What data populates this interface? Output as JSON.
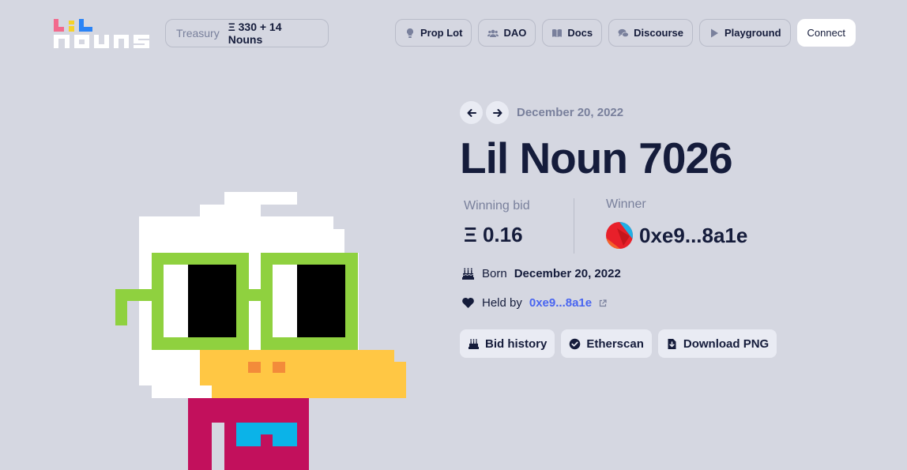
{
  "header": {
    "logo_icon": "lil-nouns-logo",
    "treasury": {
      "label": "Treasury",
      "value": "Ξ 330 + 14 Nouns"
    },
    "nav": [
      {
        "label": "Prop Lot",
        "icon": "lightbulb-icon"
      },
      {
        "label": "DAO",
        "icon": "users-icon"
      },
      {
        "label": "Docs",
        "icon": "book-icon"
      },
      {
        "label": "Discourse",
        "icon": "comments-icon"
      },
      {
        "label": "Playground",
        "icon": "play-icon"
      }
    ],
    "connect_label": "Connect"
  },
  "auction": {
    "date": "December 20, 2022",
    "title": "Lil Noun 7026",
    "winning_bid_label": "Winning bid",
    "winning_bid_value": "Ξ 0.16",
    "winner_label": "Winner",
    "winner_address": "0xe9...8a1e",
    "born_label": "Born",
    "born_date": "December 20, 2022",
    "held_label": "Held by",
    "held_by": "0xe9...8a1e",
    "actions": [
      {
        "label": "Bid history",
        "icon": "cake-icon"
      },
      {
        "label": "Etherscan",
        "icon": "check-circle-icon"
      },
      {
        "label": "Download PNG",
        "icon": "file-download-icon"
      }
    ]
  },
  "colors": {
    "background": "#d5d7e1",
    "text": "#151c3b",
    "muted": "#79809c",
    "link": "#4965f0",
    "glasses": "#8fd13f",
    "beak": "#ffc744",
    "body": "#c2105c",
    "belt_buckle": "#0bb3e8"
  }
}
